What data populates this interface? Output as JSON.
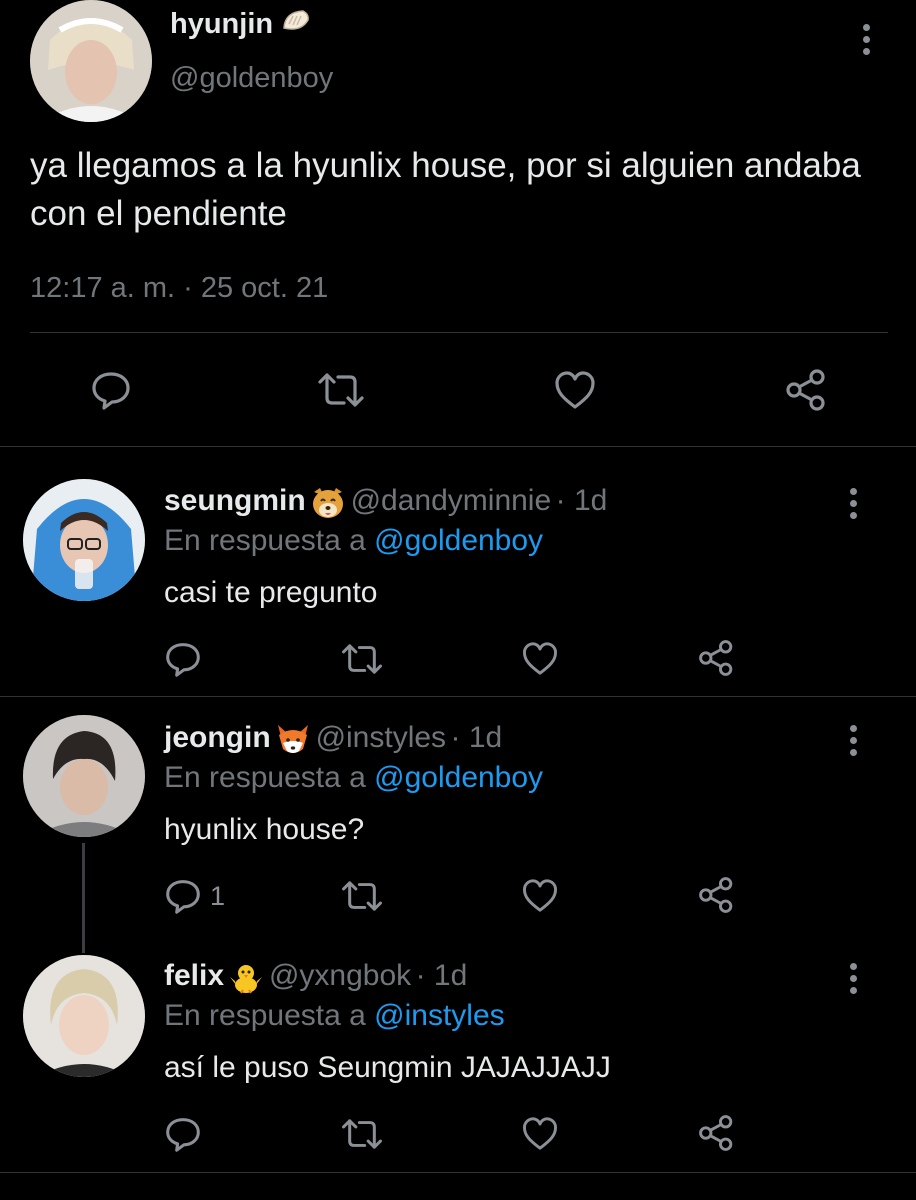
{
  "main_tweet": {
    "name": "hyunjin",
    "name_emoji": "dumpling-emoji",
    "handle": "@goldenboy",
    "text": "ya llegamos a la hyunlix house, por si alguien andaba con el pendiente",
    "timestamp": "12:17 a. m. · 25 oct. 21"
  },
  "replies": [
    {
      "name": "seungmin",
      "emoji": "dog-face-emoji",
      "handle": "@dandyminnie",
      "time": "· 1d",
      "reply_prefix": "En respuesta a",
      "reply_to": "@goldenboy",
      "text": "casi te pregunto",
      "reply_count": ""
    },
    {
      "name": "jeongin",
      "emoji": "fox-face-emoji",
      "handle": "@instyles",
      "time": "· 1d",
      "reply_prefix": "En respuesta a",
      "reply_to": "@goldenboy",
      "text": "hyunlix house?",
      "reply_count": "1"
    },
    {
      "name": "felix",
      "emoji": "baby-chick-emoji",
      "handle": "@yxngbok",
      "time": "· 1d",
      "reply_prefix": "En respuesta a",
      "reply_to": "@instyles",
      "text": "así le puso Seungmin JAJAJJAJJ",
      "reply_count": ""
    }
  ],
  "colors": {
    "background": "#000000",
    "text": "#e7e9ea",
    "secondary": "#71767b",
    "link": "#1d9bf0",
    "divider": "#2f3336"
  }
}
